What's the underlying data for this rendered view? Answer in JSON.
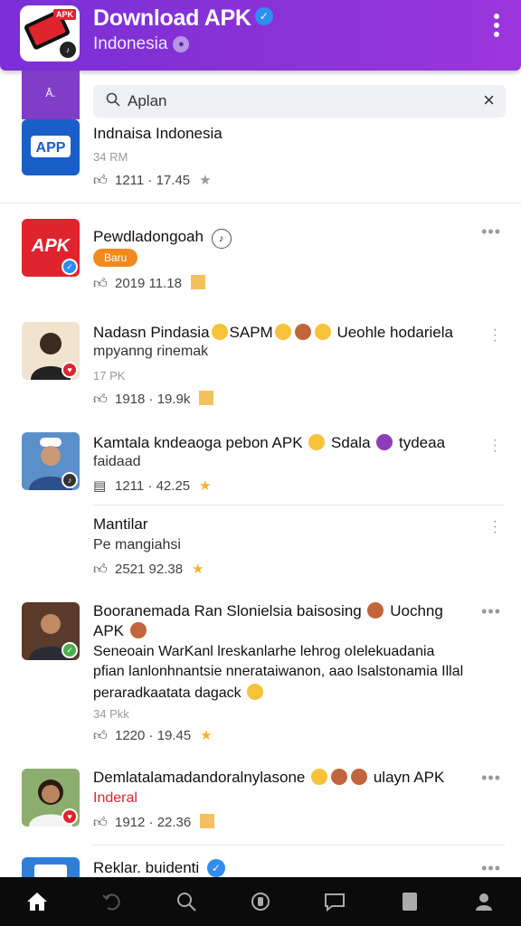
{
  "header": {
    "title": "Download APK",
    "subtitle": "Indonesia",
    "colors": {
      "bg": "#8a33d8",
      "verified": "#2f8cf0"
    }
  },
  "search": {
    "value": "Aplan",
    "clear_label": "×"
  },
  "feed": [
    {
      "title": "Indnaisa Indonesia",
      "meta": "34 RM",
      "stats": "1211 · 17.45",
      "trail_icon": "star-icon"
    },
    {
      "title": "Pewdladongoah",
      "pill": "Baru",
      "stats": "2019 11.18",
      "trail_icon": "bookmark-icon"
    },
    {
      "title": "Nadasn Pindasia",
      "title_tail": "SAPM",
      "title_end": "Ueohle hodariela",
      "line2": "mpyanng rinemak",
      "meta": "17 PK",
      "stats": "1918 · 19.9k",
      "trail_icon": "bookmark-icon"
    },
    {
      "title": "Kamtala kndeaoga pebon APK",
      "title_end": "Sdala",
      "title_tail": "tydeaa",
      "line2": "faidaad",
      "stats": "1211 · 42.25",
      "trail_icon": "star-icon"
    },
    {
      "title": "Mantilar",
      "line2": "Pe mangiahsi",
      "stats": "2521 92.38",
      "trail_icon": "star-icon"
    },
    {
      "title": "Booranemada Ran Slonielsia baisosing",
      "title_end": "Uochng",
      "title_line2": "APK",
      "body1": "Seneoain WarKanl lreskanlarhe lehrog oIelekuadania",
      "body2": "pfian lanlonhnantsie nnerataiwanon, aao lsalstonamia Illal",
      "body3": "peraradkaatata dagack",
      "meta": "34 Pkk",
      "stats": "1220 · 19.45",
      "trail_icon": "star-icon"
    },
    {
      "title": "Demlatalamadandoralnylasone",
      "title_end": "ulayn APK",
      "line2": "Inderal",
      "stats": "1912 · 22.36",
      "trail_icon": "bookmark-icon"
    },
    {
      "title": "Reklar. buidenti"
    }
  ],
  "bottom_nav": [
    {
      "icon": "home-icon"
    },
    {
      "icon": "refresh-icon"
    },
    {
      "icon": "search-icon"
    },
    {
      "icon": "record-icon"
    },
    {
      "icon": "chat-icon"
    },
    {
      "icon": "bookmark-icon"
    },
    {
      "icon": "profile-icon"
    }
  ]
}
